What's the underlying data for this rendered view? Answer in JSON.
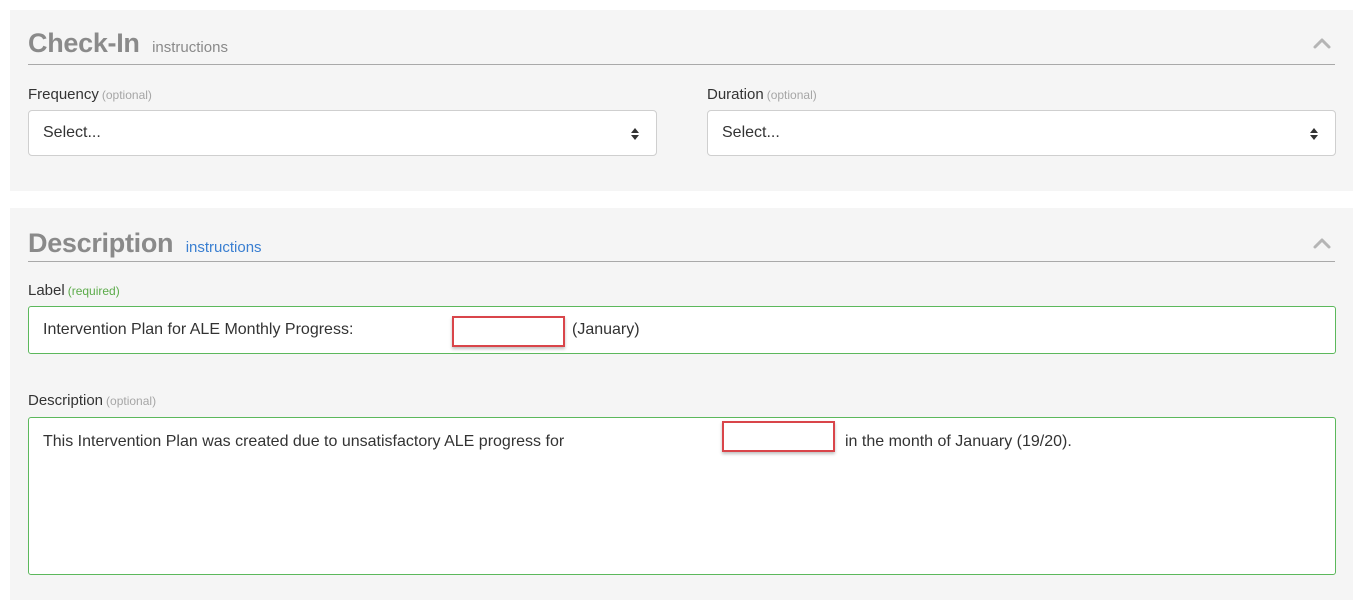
{
  "checkin": {
    "title": "Check-In",
    "instructions": "instructions",
    "frequency": {
      "label": "Frequency",
      "hint": "(optional)",
      "value": "Select..."
    },
    "duration": {
      "label": "Duration",
      "hint": "(optional)",
      "value": "Select..."
    }
  },
  "description_section": {
    "title": "Description",
    "instructions": "instructions",
    "label_field": {
      "label": "Label",
      "hint": "(required)",
      "value_before": "Intervention Plan for ALE Monthly Progress:",
      "value_after": "(January)"
    },
    "description_field": {
      "label": "Description",
      "hint": "(optional)",
      "value_before": "This Intervention Plan was created due to unsatisfactory ALE progress for",
      "value_after": "in the month of January (19/20)."
    }
  },
  "icons": {
    "collapse": "chevron-up-icon",
    "select_arrows": "sort-arrows-icon"
  },
  "colors": {
    "panel_background": "#f5f5f5",
    "title_gray": "#8a8a8a",
    "link_blue": "#3a7fd1",
    "valid_green": "#5cb85c",
    "redaction_red": "#d9454a"
  }
}
